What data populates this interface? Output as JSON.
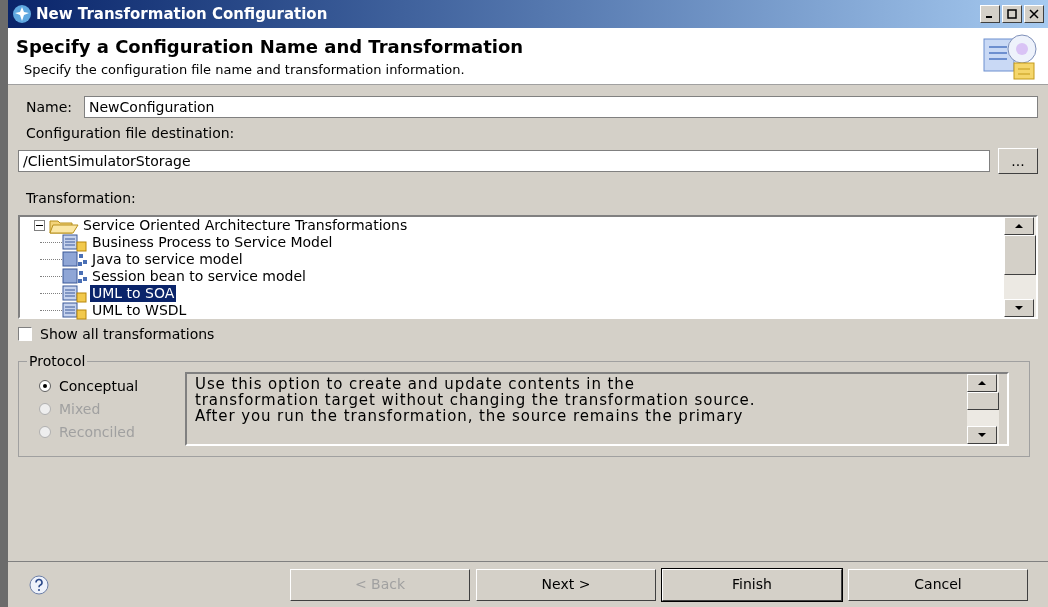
{
  "window": {
    "title": "New Transformation Configuration"
  },
  "header": {
    "title": "Specify a Configuration Name and Transformation",
    "subtitle": "Specify the configuration file name and transformation information."
  },
  "name": {
    "label": "Name:",
    "value": "NewConfiguration"
  },
  "destination": {
    "label": "Configuration file destination:",
    "value": "/ClientSimulatorStorage",
    "browse": "..."
  },
  "transformation": {
    "label": "Transformation:",
    "tree": {
      "label": "Service Oriented Architecture Transformations",
      "expanded": true,
      "children": [
        {
          "label": "Business Process to Service Model",
          "kind": "document",
          "selected": false
        },
        {
          "label": "Java to service model",
          "kind": "diagram",
          "selected": false
        },
        {
          "label": "Session bean to service model",
          "kind": "diagram",
          "selected": false
        },
        {
          "label": "UML to SOA",
          "kind": "document",
          "selected": true
        },
        {
          "label": "UML to WSDL",
          "kind": "document",
          "selected": false
        }
      ]
    }
  },
  "show_all": {
    "label": "Show all transformations",
    "checked": false
  },
  "protocol": {
    "title": "Protocol",
    "options": [
      {
        "label": "Conceptual",
        "selected": true,
        "disabled": false
      },
      {
        "label": "Mixed",
        "selected": false,
        "disabled": true
      },
      {
        "label": "Reconciled",
        "selected": false,
        "disabled": true
      }
    ],
    "description": "Use this option to create and update contents in the transformation target without changing the transformation source. After you run the transformation, the source remains the primary"
  },
  "buttons": [
    {
      "label": "< Back",
      "disabled": true,
      "default": false
    },
    {
      "label": "Next >",
      "disabled": false,
      "default": false
    },
    {
      "label": "Finish",
      "disabled": false,
      "default": true
    },
    {
      "label": "Cancel",
      "disabled": false,
      "default": false
    }
  ]
}
